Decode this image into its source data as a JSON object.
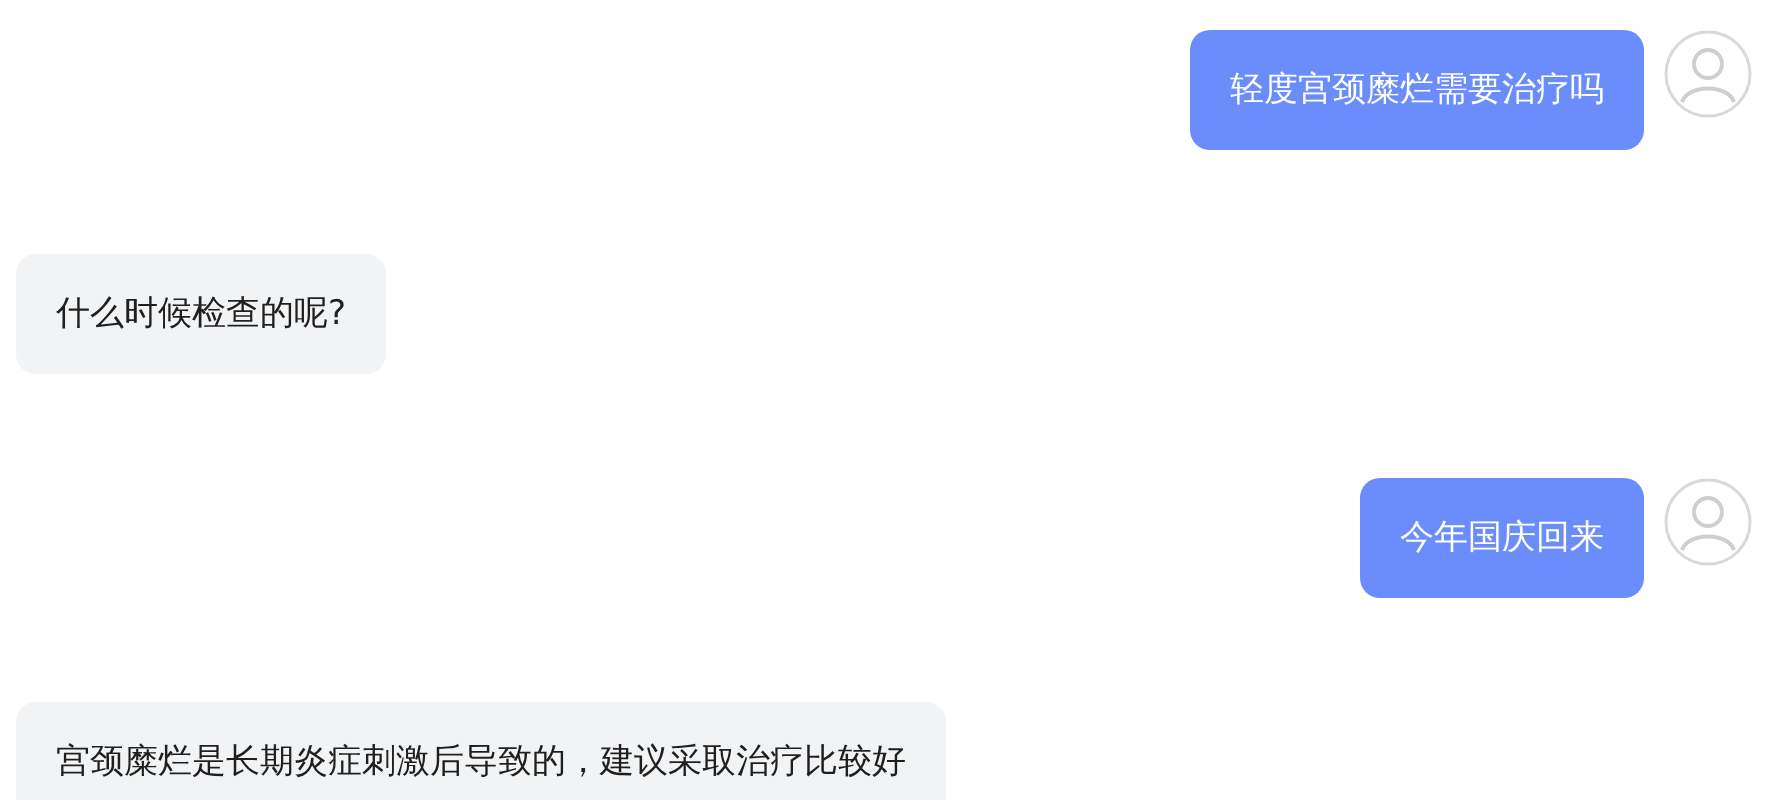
{
  "messages": [
    {
      "kind": "user",
      "text": "轻度宫颈糜烂需要治疗吗"
    },
    {
      "kind": "bot",
      "text": "什么时候检查的呢?"
    },
    {
      "kind": "user",
      "text": "今年国庆回来"
    },
    {
      "kind": "bot",
      "text": "宫颈糜烂是长期炎症刺激后导致的，建议采取治疗比较好"
    }
  ]
}
